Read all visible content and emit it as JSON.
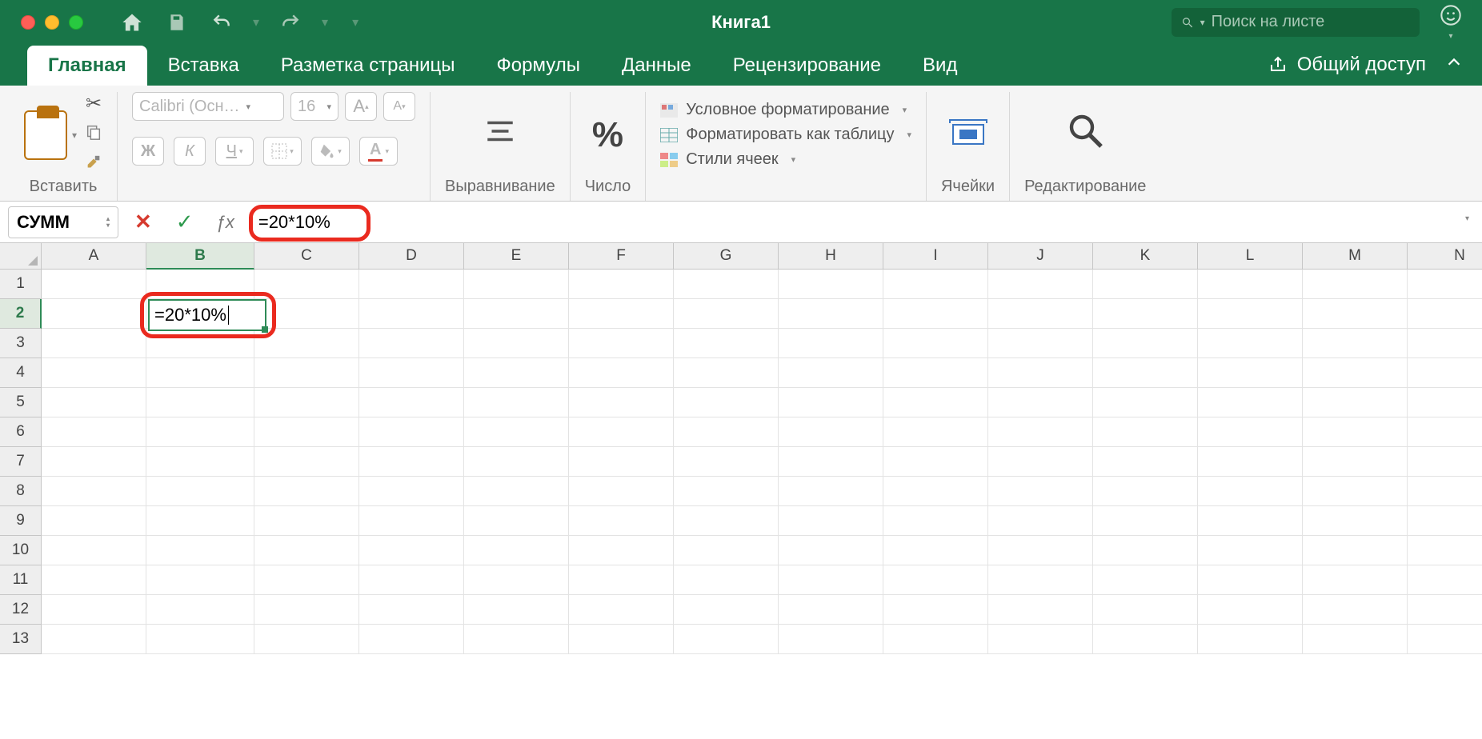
{
  "window": {
    "title": "Книга1",
    "search_placeholder": "Поиск на листе"
  },
  "tabs": {
    "items": [
      "Главная",
      "Вставка",
      "Разметка страницы",
      "Формулы",
      "Данные",
      "Рецензирование",
      "Вид"
    ],
    "active_index": 0,
    "share_label": "Общий доступ"
  },
  "ribbon": {
    "paste": {
      "label": "Вставить"
    },
    "font": {
      "name": "Calibri (Осн…",
      "size": "16",
      "bold": "Ж",
      "italic": "К",
      "underline": "Ч",
      "bigA": "A",
      "smallA": "A"
    },
    "alignment": {
      "label": "Выравнивание"
    },
    "number": {
      "label": "Число",
      "symbol": "%"
    },
    "styles": {
      "conditional": "Условное форматирование",
      "as_table": "Форматировать как таблицу",
      "cell_styles": "Стили ячеек"
    },
    "cells": {
      "label": "Ячейки"
    },
    "editing": {
      "label": "Редактирование"
    }
  },
  "formula_bar": {
    "name_box": "СУММ",
    "fx_label": "ƒx",
    "formula": "=20*10%"
  },
  "grid": {
    "columns": [
      "A",
      "B",
      "C",
      "D",
      "E",
      "F",
      "G",
      "H",
      "I",
      "J",
      "K",
      "L",
      "M",
      "N"
    ],
    "active_col_index": 1,
    "rows": [
      1,
      2,
      3,
      4,
      5,
      6,
      7,
      8,
      9,
      10,
      11,
      12,
      13
    ],
    "active_row_index": 1,
    "editing_cell": {
      "ref": "B2",
      "value": "=20*10%"
    }
  },
  "colors": {
    "brand": "#187548",
    "select": "#2e8b57",
    "callout": "#ea2a1f"
  }
}
